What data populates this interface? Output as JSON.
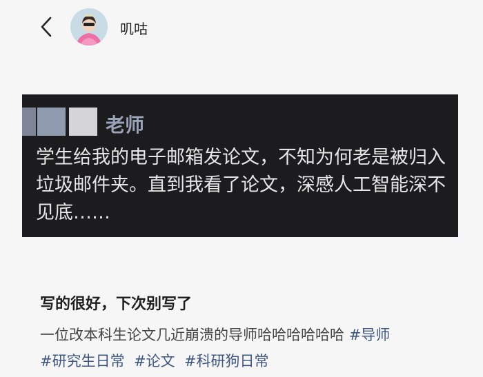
{
  "header": {
    "username": "叽咕"
  },
  "quote": {
    "name": "老师",
    "text": "学生给我的电子邮箱发论文，不知为何老是被归入垃圾邮件夹。直到我看了论文，深感人工智能深不见底……"
  },
  "post": {
    "title": "写的很好，下次别写了",
    "body": "一位改本科生论文几近崩溃的导师哈哈哈哈哈哈",
    "tags": [
      "#导师",
      "#研究生日常",
      "#论文",
      "#科研狗日常"
    ]
  },
  "colors": {
    "background": "#f6f6f7",
    "quote_background": "#1c1c1e",
    "quote_text": "#e6e6e6",
    "tag": "#3d5580"
  },
  "icons": {
    "back": "chevron-left-icon"
  }
}
